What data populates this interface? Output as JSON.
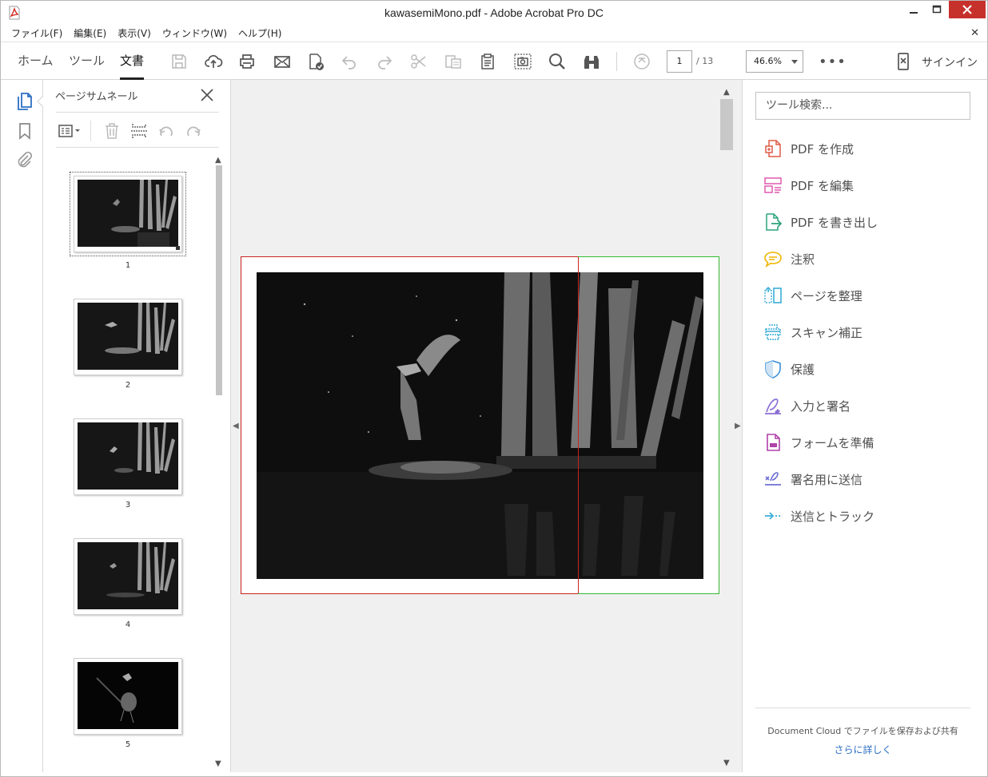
{
  "window": {
    "title": "kawasemiMono.pdf - Adobe Acrobat Pro DC"
  },
  "menu": [
    "ファイル(F)",
    "編集(E)",
    "表示(V)",
    "ウィンドウ(W)",
    "ヘルプ(H)"
  ],
  "nav_tabs": [
    "ホーム",
    "ツール",
    "文書"
  ],
  "active_tab": "文書",
  "toolbar": {
    "page_current": "1",
    "page_total": "/ 13",
    "zoom": "46.6%",
    "more": "•••",
    "signin": "サインイン"
  },
  "thumbnail_panel": {
    "title": "ページサムネール",
    "pages": [
      "1",
      "2",
      "3",
      "4",
      "5"
    ]
  },
  "tools_pane": {
    "search_placeholder": "ツール検索...",
    "items": [
      {
        "label": "PDF を作成",
        "icon": "create-pdf-icon",
        "color": "#e05a47"
      },
      {
        "label": "PDF を編集",
        "icon": "edit-pdf-icon",
        "color": "#e05ab0"
      },
      {
        "label": "PDF を書き出し",
        "icon": "export-pdf-icon",
        "color": "#2ba37c"
      },
      {
        "label": "注釈",
        "icon": "comment-icon",
        "color": "#f0b400"
      },
      {
        "label": "ページを整理",
        "icon": "organize-pages-icon",
        "color": "#3aaed8"
      },
      {
        "label": "スキャン補正",
        "icon": "scan-icon",
        "color": "#3aaed8"
      },
      {
        "label": "保護",
        "icon": "shield-icon",
        "color": "#3a8fd8"
      },
      {
        "label": "入力と署名",
        "icon": "fill-sign-icon",
        "color": "#8b6fd6"
      },
      {
        "label": "フォームを準備",
        "icon": "form-icon",
        "color": "#b042a8"
      },
      {
        "label": "署名用に送信",
        "icon": "send-signature-icon",
        "color": "#6f6fd6"
      },
      {
        "label": "送信とトラック",
        "icon": "send-track-icon",
        "color": "#3aaed8"
      }
    ],
    "cloud_text": "Document Cloud でファイルを保存および共有",
    "cloud_link": "さらに詳しく"
  }
}
